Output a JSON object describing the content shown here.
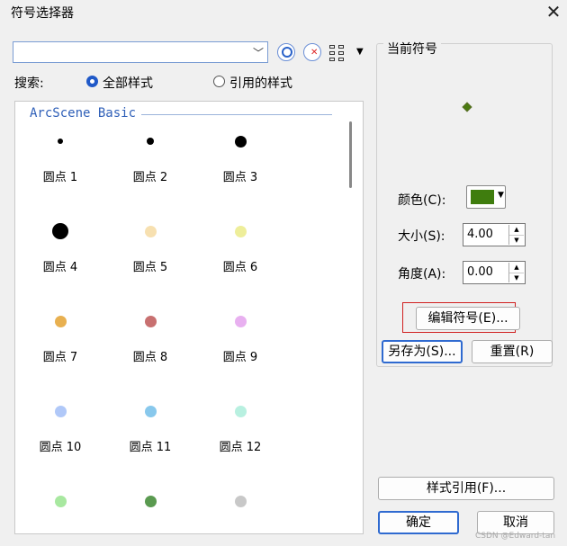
{
  "window": {
    "title": "符号选择器",
    "close_icon": "close-icon"
  },
  "search": {
    "value": "",
    "label": "搜索:",
    "options": [
      "全部样式",
      "引用的样式"
    ],
    "selected": "全部样式"
  },
  "toolbar": {
    "icons": [
      "search-icon",
      "clear-search-icon",
      "view-grid-icon",
      "dropdown-arrow-icon"
    ]
  },
  "gallery": {
    "group_title": "ArcScene Basic",
    "items": [
      {
        "label": "圆点 1",
        "color": "#000000"
      },
      {
        "label": "圆点 2",
        "color": "#000000"
      },
      {
        "label": "圆点 3",
        "color": "#000000"
      },
      {
        "label": "圆点 4",
        "color": "#000000"
      },
      {
        "label": "圆点 5",
        "color": "#f7e0b0"
      },
      {
        "label": "圆点 6",
        "color": "#eeee9a"
      },
      {
        "label": "圆点 7",
        "color": "#e8b050"
      },
      {
        "label": "圆点 8",
        "color": "#c87070"
      },
      {
        "label": "圆点 9",
        "color": "#e8b0f0"
      },
      {
        "label": "圆点 10",
        "color": "#b0c8f8"
      },
      {
        "label": "圆点 11",
        "color": "#88c8ec"
      },
      {
        "label": "圆点 12",
        "color": "#b8f0e0"
      },
      {
        "label": "",
        "color": "#a8e8a0"
      },
      {
        "label": "",
        "color": "#5a9a50"
      },
      {
        "label": "",
        "color": "#c8c8c8"
      }
    ]
  },
  "current_symbol": {
    "title": "当前符号",
    "color_label": "颜色(C):",
    "color": "#3f7d0e",
    "size_label": "大小(S):",
    "size": "4.00",
    "angle_label": "角度(A):",
    "angle": "0.00"
  },
  "buttons": {
    "edit_symbol": "编辑符号(E)...",
    "save_as": "另存为(S)...",
    "reset": "重置(R)",
    "style_references": "样式引用(F)...",
    "ok": "确定",
    "cancel": "取消"
  },
  "watermark": "CSDN @Edward-tan"
}
